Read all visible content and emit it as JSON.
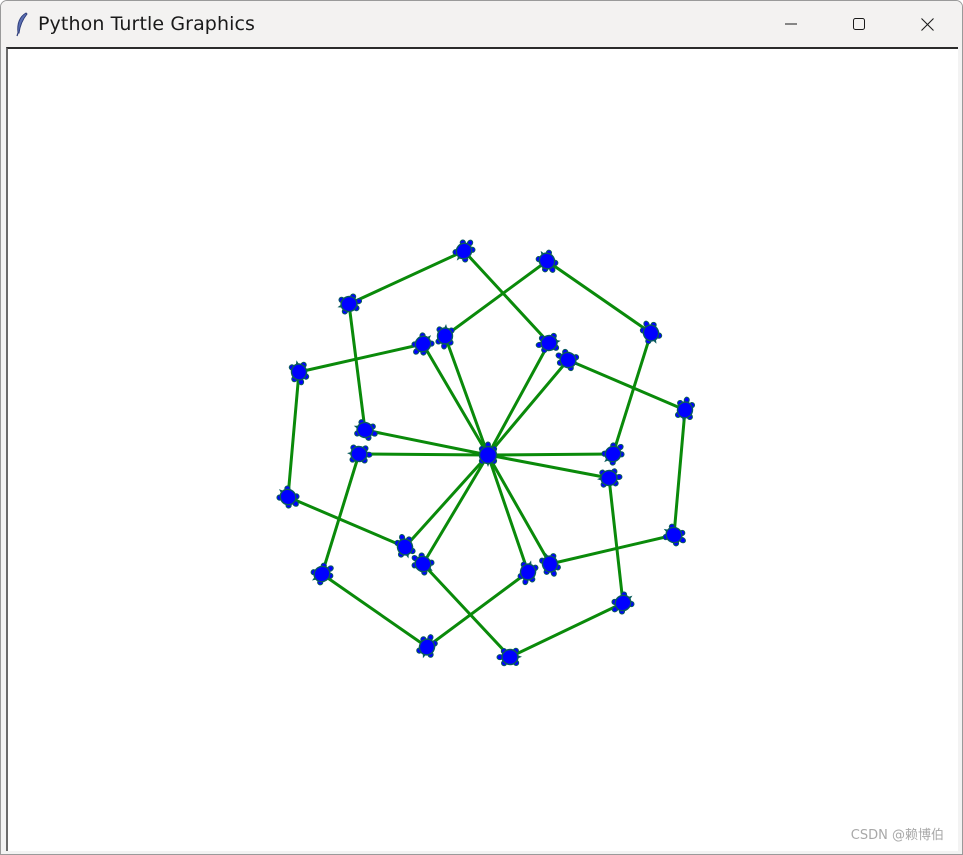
{
  "window": {
    "title": "Python Turtle Graphics",
    "app_icon": "feather-icon",
    "controls": [
      "minimize-icon",
      "maximize-icon",
      "close-icon"
    ]
  },
  "canvas": {
    "background": "#ffffff",
    "line_color": "#0a8a0a",
    "turtle_fill": "#0000ff",
    "turtle_outline": "#0a5c5c"
  },
  "watermark": "CSDN @赖博伯"
}
